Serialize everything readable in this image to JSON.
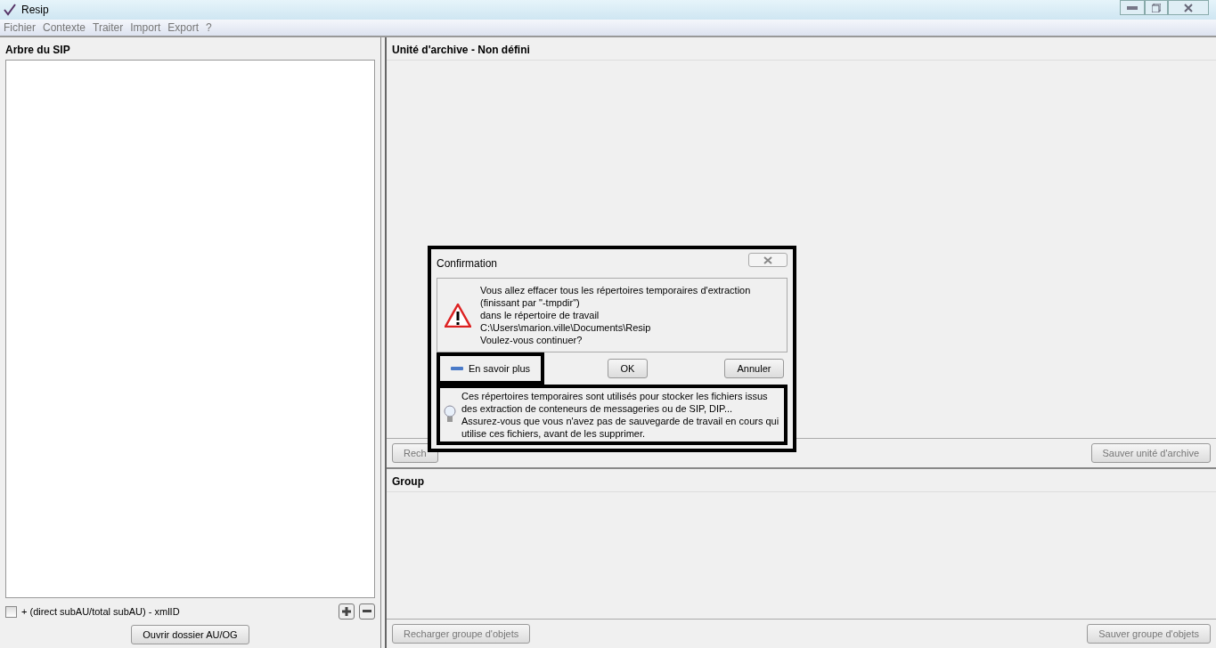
{
  "window": {
    "title": "Resip"
  },
  "menu": [
    {
      "label": "Fichier"
    },
    {
      "label": "Contexte"
    },
    {
      "label": "Traiter"
    },
    {
      "label": "Import"
    },
    {
      "label": "Export"
    },
    {
      "label": "?"
    }
  ],
  "tree_panel": {
    "title": "Arbre du SIP",
    "option": {
      "label": "+ (direct subAU/total subAU) - xmlID",
      "checked": false
    },
    "open_button": "Ouvrir dossier AU/OG"
  },
  "archive_unit_panel": {
    "title": "Unité d'archive - Non défini",
    "buttons": [
      {
        "label": "Rech",
        "disabled": true
      },
      {
        "label": "Sauver unité d'archive",
        "disabled": true
      }
    ]
  },
  "object_group_panel": {
    "title": "Group",
    "buttons": [
      {
        "label": "Recharger groupe d'objets",
        "disabled": true
      },
      {
        "label": "Sauver groupe d'objets",
        "disabled": true
      }
    ]
  },
  "dialog": {
    "title": "Confirmation",
    "message": [
      "Vous allez effacer tous les répertoires temporaires d'extraction",
      "(finissant par \"-tmpdir\")",
      "dans le répertoire de travail",
      "C:\\Users\\marion.ville\\Documents\\Resip",
      "Voulez-vous continuer?"
    ],
    "details_toggle": {
      "label": "En savoir plus",
      "expanded": true
    },
    "buttons": [
      "OK",
      "Annuler"
    ],
    "details": [
      "Ces répertoires temporaires sont utilisés pour stocker les fichiers issus",
      "des extraction de conteneurs de messageries ou de SIP, DIP...",
      "Assurez-vous que vous n'avez pas de sauvegarde de travail en cours qui",
      "utilise ces fichiers, avant de les supprimer."
    ]
  }
}
